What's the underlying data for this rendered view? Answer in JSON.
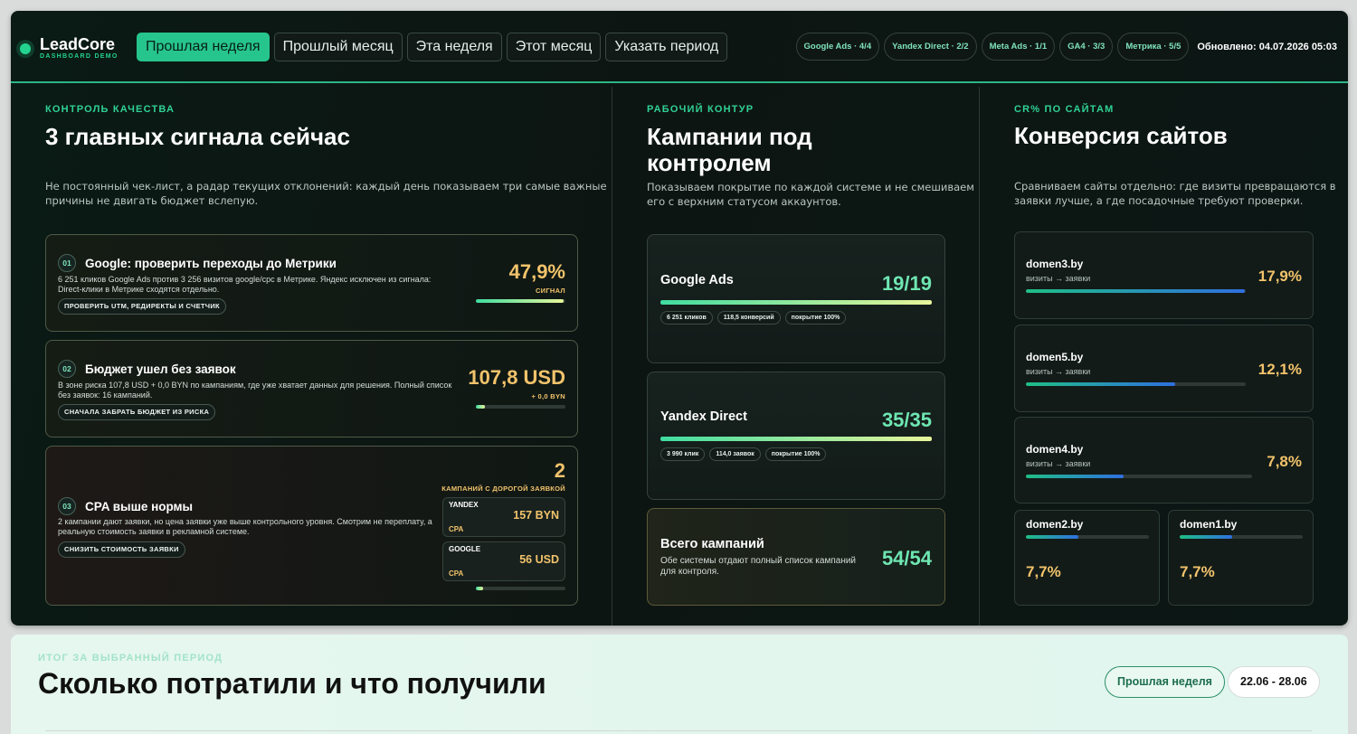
{
  "header": {
    "logo_name": "LeadCore",
    "logo_sub": "DASHBOARD DEMO",
    "periods": [
      "Прошлая неделя",
      "Прошлый месяц",
      "Эта неделя",
      "Этот месяц",
      "Указать период"
    ],
    "active_period": 0,
    "sources": [
      "Google Ads · 4/4",
      "Yandex Direct · 2/2",
      "Meta Ads · 1/1",
      "GA4 · 3/3",
      "Метрика · 5/5"
    ],
    "updated": "Обновлено: 04.07.2026 05:03"
  },
  "quality": {
    "eyebrow": "КОНТРОЛЬ КАЧЕСТВА",
    "title": "3 главных сигнала сейчас",
    "desc_line1": "Не постоянный чек-лист, а радар текущих отклонений: каждый день показываем три самые важные",
    "desc_line2": "причины не двигать бюджет вслепую.",
    "signals": [
      {
        "num": "01",
        "title": "Google: проверить переходы до Метрики",
        "desc_line1": "6 251 кликов Google Ads против 3 256 визитов google/cpc в Метрике. Яндекс исключен из сигнала:",
        "desc_line2": "Direct-клики в Метрике сходятся отдельно.",
        "action": "ПРОВЕРИТЬ UTM, РЕДИРЕКТЫ И СЧЕТЧИК",
        "value": "47,9%",
        "value_sub": "СИГНАЛ",
        "progress": 0.98
      },
      {
        "num": "02",
        "title": "Бюджет ушел без заявок",
        "desc_line1": "В зоне риска 107,8 USD + 0,0 BYN по кампаниям, где уже хватает данных для решения. Полный список",
        "desc_line2": "без заявок: 16 кампаний.",
        "action": "СНАЧАЛА ЗАБРАТЬ БЮДЖЕТ ИЗ РИСКА",
        "value": "107,8 USD",
        "value_sub": "+ 0,0 BYN",
        "progress": 0.1
      },
      {
        "num": "03",
        "title": "CPA выше нормы",
        "desc_line1": "2 кампании дают заявки, но цена заявки уже выше контрольного уровня. Смотрим не переплату, а",
        "desc_line2": "реальную стоимость заявки в рекламной системе.",
        "action": "СНИЗИТЬ СТОИМОСТЬ ЗАЯВКИ",
        "value": "2",
        "value_sub": "КАМПАНИЙ С ДОРОГОЙ ЗАЯВКОЙ",
        "progress": 0.08,
        "cpa": [
          {
            "system": "YANDEX",
            "label": "CPA",
            "value": "157 BYN"
          },
          {
            "system": "GOOGLE",
            "label": "CPA",
            "value": "56 USD"
          }
        ]
      }
    ]
  },
  "campaigns": {
    "eyebrow": "РАБОЧИЙ КОНТУР",
    "title_line1": "Кампании под",
    "title_line2": "контролем",
    "desc_line1": "Показываем покрытие по каждой системе и не смешиваем",
    "desc_line2": "его с верхним статусом аккаунтов.",
    "items": [
      {
        "name": "Google Ads",
        "value": "19/19",
        "coverage": 1.0,
        "chips": [
          "6 251 кликов",
          "118,5 конверсий",
          "покрытие 100%"
        ]
      },
      {
        "name": "Yandex Direct",
        "value": "35/35",
        "coverage": 1.0,
        "chips": [
          "3 990 клик",
          "114,0 заявок",
          "покрытие 100%"
        ]
      }
    ],
    "total": {
      "name": "Всего кампаний",
      "value": "54/54",
      "desc_line1": "Обе системы отдают полный список кампаний",
      "desc_line2": "для контроля."
    }
  },
  "sites": {
    "eyebrow": "CR% ПО САЙТАМ",
    "title": "Конверсия сайтов",
    "desc_line1": "Сравниваем сайты отдельно: где визиты превращаются в",
    "desc_line2": "заявки лучше, а где посадочные требуют проверки.",
    "subtitle": "визиты → заявки",
    "items": [
      {
        "name": "domen3.by",
        "value": "17,9%",
        "cr": 0.995
      },
      {
        "name": "domen5.by",
        "value": "12,1%",
        "cr": 0.68
      },
      {
        "name": "domen4.by",
        "value": "7,8%",
        "cr": 0.43
      },
      {
        "name": "domen2.by",
        "value": "7,7%",
        "cr": 0.43
      },
      {
        "name": "domen1.by",
        "value": "7,7%",
        "cr": 0.43
      }
    ]
  },
  "summary": {
    "eyebrow": "ИТОГ ЗА ВЫБРАННЫЙ ПЕРИОД",
    "title": "Сколько потратили и что получили",
    "period_label": "Прошлая неделя",
    "dates": "22.06 - 28.06"
  },
  "colors": {
    "accent": "#27c58e",
    "value_gold": "#f2c36b",
    "value_green": "#6ee6b2",
    "bar_gradient_start": "#3fdca0",
    "bar_gradient_end": "#e8f59a",
    "site_bar_start": "#1fbf86",
    "site_bar_end": "#2f6fe0"
  }
}
